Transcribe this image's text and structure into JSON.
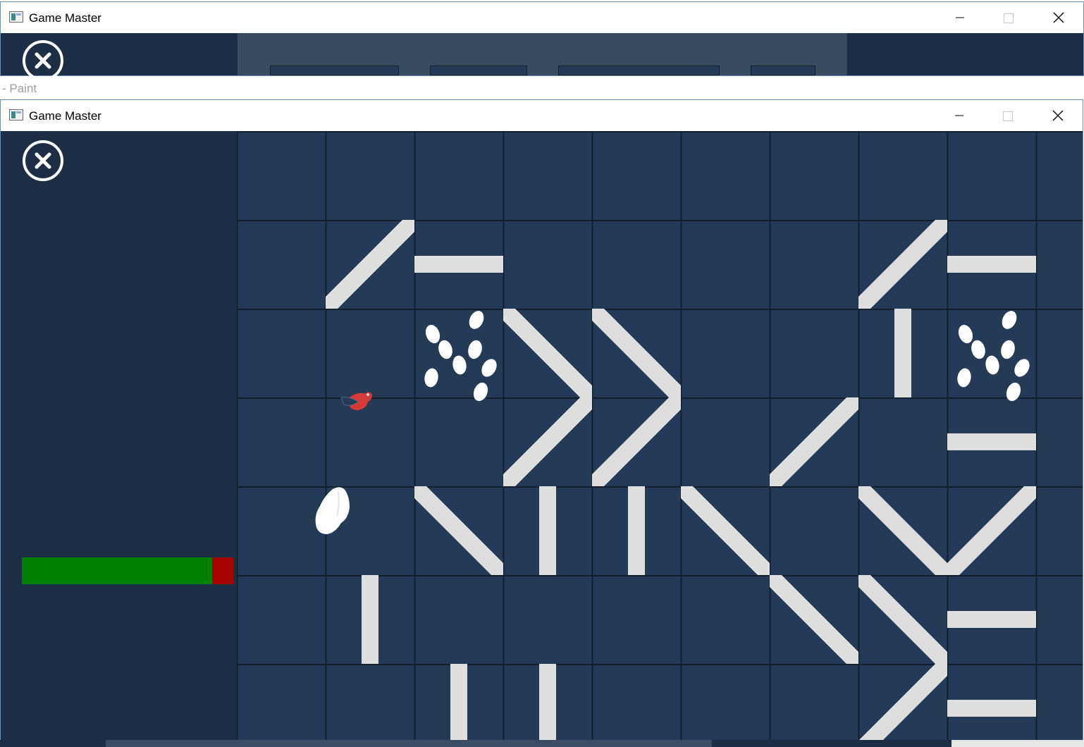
{
  "background_window": {
    "title": "Game Master",
    "controls": [
      "minimize",
      "maximize",
      "close"
    ]
  },
  "paint_window": {
    "title": "- Paint"
  },
  "game_window": {
    "title": "Game Master",
    "controls": [
      "minimize",
      "maximize",
      "close"
    ],
    "close_icon": "close-circle-icon",
    "health": 0.9,
    "colors": {
      "panel": "#1e2f45",
      "board": "#253a56",
      "grid": "#141f2c",
      "wall": "#dedede",
      "health_fill": "#008000",
      "health_empty": "#a80000"
    },
    "board": {
      "cols": 10,
      "rows": 7,
      "walls": [
        [
          "d2",
          1,
          1
        ],
        [
          "h",
          2,
          1
        ],
        [
          "d2",
          7,
          1
        ],
        [
          "h",
          8,
          1
        ],
        [
          "d1",
          3,
          2
        ],
        [
          "d2",
          3,
          3
        ],
        [
          "d2",
          4,
          3
        ],
        [
          "d1",
          4,
          2
        ],
        [
          "v",
          7,
          2
        ],
        [
          "d2",
          6,
          3
        ],
        [
          "h",
          8,
          3
        ],
        [
          "d1",
          2,
          4
        ],
        [
          "v",
          3,
          4
        ],
        [
          "v",
          4,
          4
        ],
        [
          "d1",
          5,
          4
        ],
        [
          "d1",
          7,
          4
        ],
        [
          "d2",
          8,
          4
        ],
        [
          "v",
          1,
          5
        ],
        [
          "d1",
          6,
          5
        ],
        [
          "d1",
          7,
          5
        ],
        [
          "h",
          8,
          5
        ],
        [
          "v",
          2,
          6
        ],
        [
          "v",
          3,
          6
        ],
        [
          "d2",
          7,
          6
        ],
        [
          "h",
          8,
          6
        ]
      ],
      "seeds": [
        [
          2,
          2
        ],
        [
          8,
          2
        ]
      ],
      "bird": {
        "col": 1,
        "row": 3
      },
      "creature": {
        "col": 1,
        "row": 4
      }
    }
  }
}
